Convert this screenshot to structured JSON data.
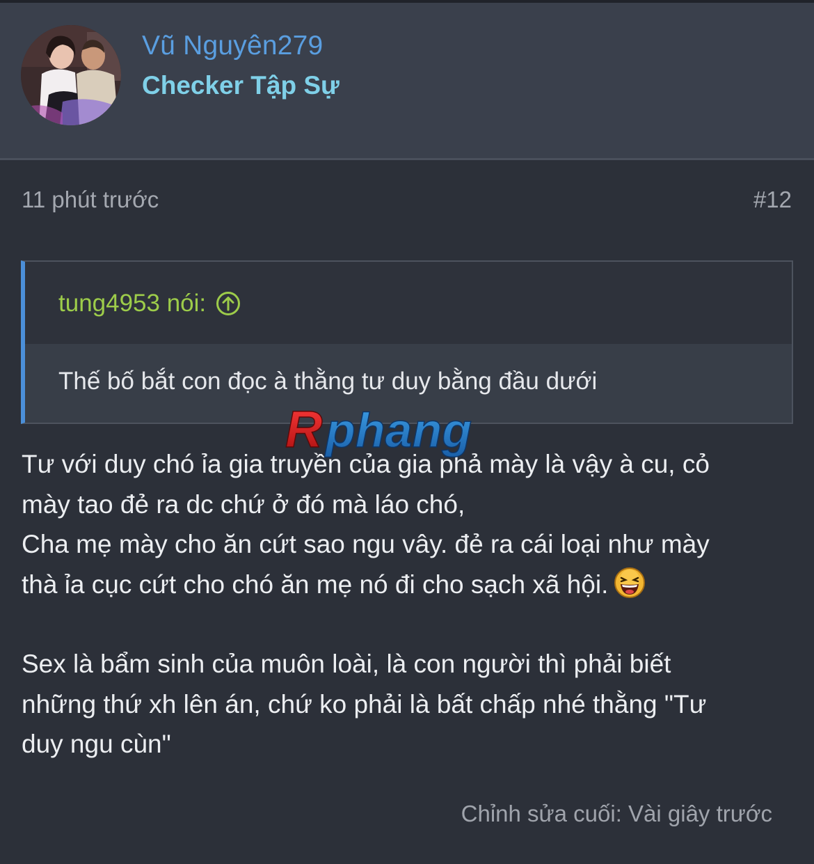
{
  "user": {
    "name": "Vũ Nguyên279",
    "title": "Checker Tập Sự"
  },
  "post": {
    "time": "11 phút trước",
    "number": "#12",
    "quote": {
      "author": "tung4953 nói:",
      "text": "Thế bố bắt con đọc à thằng tư duy bằng đầu dưới"
    },
    "message": {
      "line1": "Tư với duy chó ỉa gia truyền của gia phả mày là vậy à cu, cỏ",
      "line2": "mày tao đẻ ra dc chứ ở đó mà láo chó,",
      "line3": "Cha mẹ mày cho ăn cứt sao ngu vây. đẻ ra cái loại như mày",
      "line4": "thà ỉa cục cứt cho chó ăn mẹ nó đi cho sạch xã hội.",
      "line5": "Sex là bẩm sinh của muôn loài, là con người thì phải biết",
      "line6": "những thứ xh lên án, chứ ko phải là bất chấp nhé thằng \"Tư",
      "line7": "duy ngu cùn\""
    },
    "edited": "Chỉnh sửa cuối: Vài giây trước"
  },
  "watermark": {
    "part1": "R",
    "part2": "phang"
  },
  "colors": {
    "background": "#2c3039",
    "header": "#3a404c",
    "username": "#5a9ee0",
    "user_title": "#7fd0e8",
    "quote_author": "#9dcc4a",
    "quote_border": "#4b8fd8"
  },
  "icons": {
    "quote_jump": "arrow-up-circle-icon",
    "emoji": "laughing-emoji-icon"
  }
}
